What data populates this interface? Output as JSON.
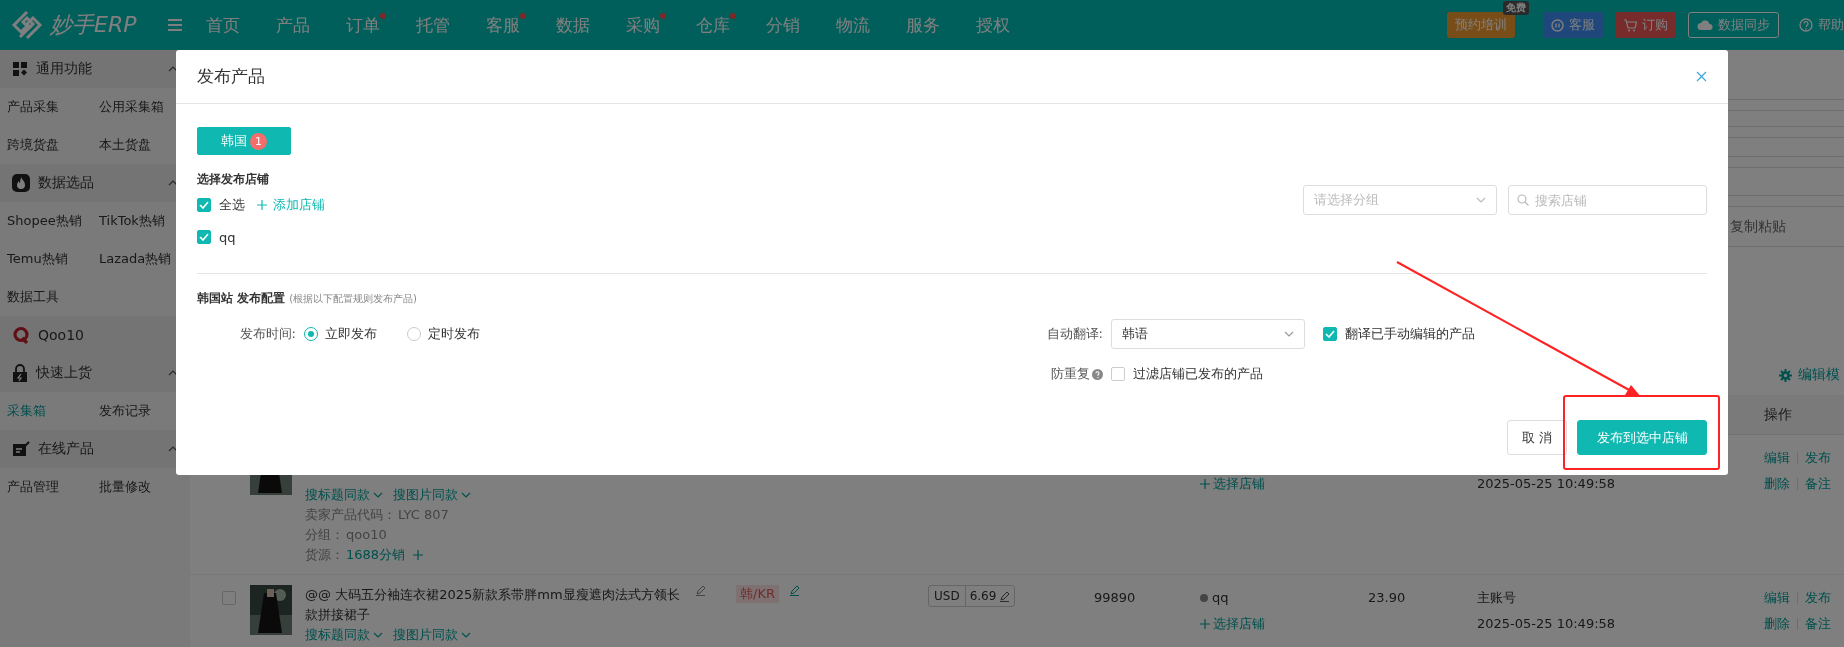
{
  "top_bar": {
    "logo_text": "妙手ERP",
    "nav": [
      {
        "label": "首页",
        "dot": false
      },
      {
        "label": "产品",
        "dot": false
      },
      {
        "label": "订单",
        "dot": true
      },
      {
        "label": "托管",
        "dot": false
      },
      {
        "label": "客服",
        "dot": true
      },
      {
        "label": "数据",
        "dot": false
      },
      {
        "label": "采购",
        "dot": true
      },
      {
        "label": "仓库",
        "dot": true
      },
      {
        "label": "分销",
        "dot": false
      },
      {
        "label": "物流",
        "dot": false
      },
      {
        "label": "服务",
        "dot": false
      },
      {
        "label": "授权",
        "dot": false
      }
    ],
    "actions": [
      {
        "kind": "training",
        "label": "预约培训",
        "badge": "免费"
      },
      {
        "kind": "service",
        "label": "客服"
      },
      {
        "kind": "order",
        "label": "订购"
      },
      {
        "kind": "sync",
        "label": "数据同步"
      },
      {
        "kind": "help",
        "label": "帮助"
      }
    ]
  },
  "sidebar": {
    "sections": [
      {
        "title": "通用功能",
        "kind": "grid",
        "expanded": true,
        "items": [
          {
            "label": "产品采集",
            "selected": false
          },
          {
            "label": "公用采集箱",
            "selected": false
          },
          {
            "label": "跨境货盘",
            "selected": false
          },
          {
            "label": "本土货盘",
            "selected": false
          }
        ]
      },
      {
        "title": "数据选品",
        "kind": "fire",
        "expanded": true,
        "items": [
          {
            "label": "Shopee热销",
            "selected": false
          },
          {
            "label": "TikTok热销",
            "selected": false
          },
          {
            "label": "Temu热销",
            "selected": false
          },
          {
            "label": "Lazada热销",
            "selected": false
          },
          {
            "label": "数据工具",
            "selected": false
          }
        ]
      },
      {
        "title": "Qoo10",
        "kind": "qoo10"
      },
      {
        "title": "快速上货",
        "kind": "lock",
        "expanded": true,
        "items": [
          {
            "label": "采集箱",
            "selected": true
          },
          {
            "label": "发布记录",
            "selected": false
          }
        ]
      },
      {
        "title": "在线产品",
        "kind": "edit",
        "expanded": true,
        "items": [
          {
            "label": "产品管理",
            "selected": false
          },
          {
            "label": "批量修改",
            "selected": false
          }
        ]
      }
    ]
  },
  "page_behind": {
    "toolbar_text": "复制粘贴",
    "edit_mode": "编辑模",
    "ops_header": "操作",
    "rows": [
      {
        "links": [
          "搜标题同款",
          "搜图片同款"
        ],
        "meta": [
          {
            "label": "卖家产品代码：",
            "value": "LYC 807",
            "kind": "plain"
          },
          {
            "label": "分组：",
            "value": "qoo10",
            "kind": "plain"
          },
          {
            "label": "货源：",
            "value": "1688分销",
            "kind": "source"
          }
        ],
        "store_action": "选择店铺",
        "time": "2025-05-25 10:49:58",
        "ops": [
          [
            "编辑",
            "发布"
          ],
          [
            "删除",
            "备注"
          ]
        ]
      },
      {
        "checked": false,
        "title": "@@ 大码五分袖连衣裙2025新款系带胖mm显瘦遮肉法式方领长款拼接裙子",
        "tag": "韩/KR",
        "currency": "USD",
        "price": "6.69",
        "stock": "99890",
        "store": "qq",
        "store_action": "选择店铺",
        "price2": "23.90",
        "account": "主账号",
        "time": "2025-05-25 10:49:58",
        "links": [
          "搜标题同款",
          "搜图片同款"
        ],
        "ops": [
          [
            "编辑",
            "发布"
          ],
          [
            "删除",
            "备注"
          ]
        ]
      }
    ]
  },
  "modal": {
    "title": "发布产品",
    "tabs": [
      {
        "label": "韩国",
        "badge": "1",
        "selected": true
      }
    ],
    "shop_section": {
      "title": "选择发布店铺",
      "select_all": {
        "label": "全选",
        "checked": true
      },
      "add_link": "添加店铺",
      "shops": [
        {
          "label": "qq",
          "checked": true
        }
      ],
      "group_select": {
        "placeholder": "请选择分组"
      },
      "search": {
        "placeholder": "搜索店铺"
      }
    },
    "config": {
      "title": "韩国站 发布配置",
      "note": "(根据以下配置规则发布产品)",
      "publish_time": {
        "label": "发布时间:",
        "options": [
          {
            "label": "立即发布",
            "selected": true
          },
          {
            "label": "定时发布",
            "selected": false
          }
        ]
      },
      "translate": {
        "label": "自动翻译:",
        "value": "韩语",
        "option": {
          "label": "翻译已手动编辑的产品",
          "checked": true
        }
      },
      "dedupe": {
        "label": "防重复",
        "option": {
          "label": "过滤店铺已发布的产品",
          "checked": false
        }
      }
    },
    "buttons": [
      {
        "label": "取 消",
        "kind": "default"
      },
      {
        "label": "发布到选中店铺",
        "kind": "primary"
      }
    ]
  }
}
